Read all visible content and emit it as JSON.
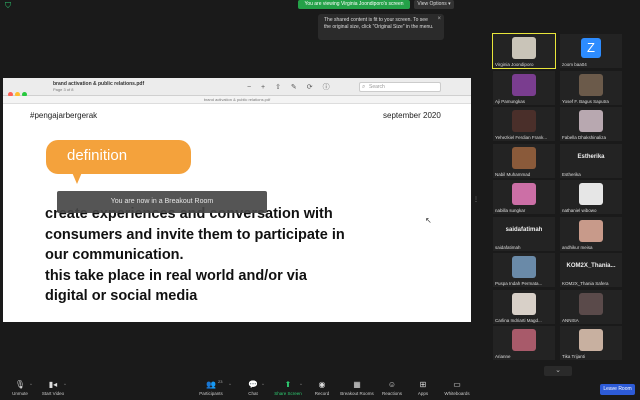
{
  "top": {
    "viewing_text": "You are viewing Virginia Joondiporo's screen",
    "view_options_label": "View Options ▾",
    "tooltip_text": "The shared content is fit to your screen. To see the original size, click \"Original Size\" in the menu.",
    "tooltip_close": "×"
  },
  "viewer": {
    "file_title": "brand activation & public relations.pdf",
    "page_info": "Page 3 of 8",
    "subtitle_bar": "brand activation & public relations.pdf",
    "search_placeholder": "Search",
    "zoom_out_icon": "−",
    "zoom_in_icon": "+",
    "share_icon": "⇧",
    "pen_icon": "✎",
    "rotate_icon": "⟳",
    "info_icon": "ⓘ"
  },
  "slide": {
    "hashtag": "#pengajarbergerak",
    "date": "september 2020",
    "definition_label": "definition",
    "breakout_notice": "You are now in a Breakout Room",
    "body_lines": [
      "create experiences and conversation with",
      "consumers and invite them to participate in",
      "our communication.",
      "this take place in real world and/or via",
      "digital or social media"
    ]
  },
  "gallery": {
    "participants": [
      {
        "name": "Virginia Joondiporo",
        "avatar_color": "#c9c4b8",
        "active": true
      },
      {
        "name": "zoom baa04",
        "letter": "Z"
      },
      {
        "name": "Aji Pamungkas",
        "avatar_color": "#7a3d8f"
      },
      {
        "name": "Yosef F. Bagus Saputra",
        "avatar_color": "#6b5a4a"
      },
      {
        "name": "Yehezkiel Ferdian Frank...",
        "avatar_color": "#4a2f2a"
      },
      {
        "name": "Fabella Dhakshinaliza",
        "avatar_color": "#b8a8b0"
      },
      {
        "name": "Nabil Muhammad",
        "avatar_color": "#8a5a3a"
      },
      {
        "name": "Estherika",
        "name_center": "Estherika"
      },
      {
        "name": "nabilla sungkar",
        "avatar_color": "#cc6fa6"
      },
      {
        "name": "nathaniel wibowo",
        "avatar_color": "#e6e6e6"
      },
      {
        "name": "saidafatimah",
        "name_center": "saidafatimah"
      },
      {
        "name": "andhikur meisa",
        "avatar_color": "#c89a8a"
      },
      {
        "name": "Puspa Indah Permata...",
        "avatar_color": "#6a8aa8"
      },
      {
        "name": "KOM2X_Thania Safera",
        "name_center": "KOM2X_Thania..."
      },
      {
        "name": "Carlina Indriarti Magd...",
        "avatar_color": "#d8d0c8"
      },
      {
        "name": "ANNISA",
        "avatar_color": "#5a4a4a"
      },
      {
        "name": "Arianne",
        "avatar_color": "#a85a6a"
      },
      {
        "name": "Tika Trijanti",
        "avatar_color": "#c8b0a0"
      }
    ],
    "down_arrow": "⌄"
  },
  "toolbar": {
    "unmute": "Unmute",
    "start_video": "Start Video",
    "participants": "Participants",
    "participants_count": "23",
    "chat": "Chat",
    "share_screen": "Share Screen",
    "record": "Record",
    "breakout_rooms": "Breakout Rooms",
    "reactions": "Reactions",
    "apps": "Apps",
    "whiteboards": "Whiteboards",
    "leave": "Leave Room"
  }
}
